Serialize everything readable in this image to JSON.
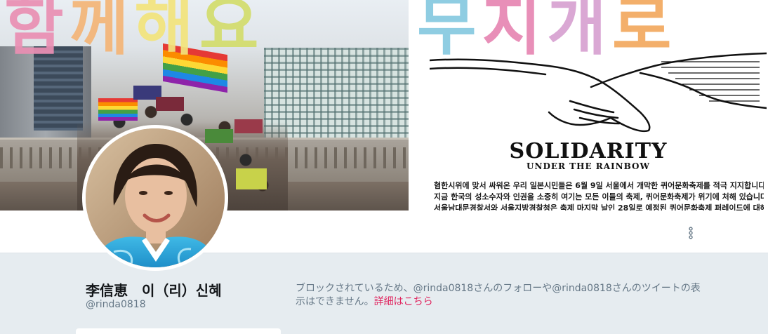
{
  "banner": {
    "headline_left": [
      "함",
      "께",
      "해",
      "요"
    ],
    "headline_right": [
      "무",
      "지",
      "개",
      "로"
    ],
    "poster_title": "SOLIDARITY",
    "poster_subtitle": "UNDER THE RAINBOW",
    "poster_lines": [
      "혐한시위에 맞서 싸워온 우리 일본시민들은 6월 9일 서울에서 개막한 퀴어문화축제를 적극 지지합니다.",
      "지금 한국의 성소수자와 인권을 소중히 여기는 모든 이들의 축제, 퀴어문화축제가 위기에 처해 있습니다.",
      "서울남대문경찰서와 서울지방경찰청은 축제 마지막 날인 28일로 예정된 퀴어문화축제 퍼레이드에 대해"
    ],
    "colors": [
      "#ea8fb3",
      "#f4b577",
      "#f3e47c",
      "#d3dd6c",
      "#86c9e0",
      "#e786b3",
      "#d7a1d1",
      "#f3a95f"
    ]
  },
  "profile": {
    "display_name": "李信恵　이（리）신혜",
    "handle": "@rinda0818",
    "blocked_message": "ブロックされているため、@rinda0818さんのフォローや@rinda0818さんのツイートの表示はできません。",
    "details_link": "詳細はこちら",
    "link_color": "#e0245e"
  },
  "actions": {
    "more_icon": "more-vertical-icon"
  }
}
